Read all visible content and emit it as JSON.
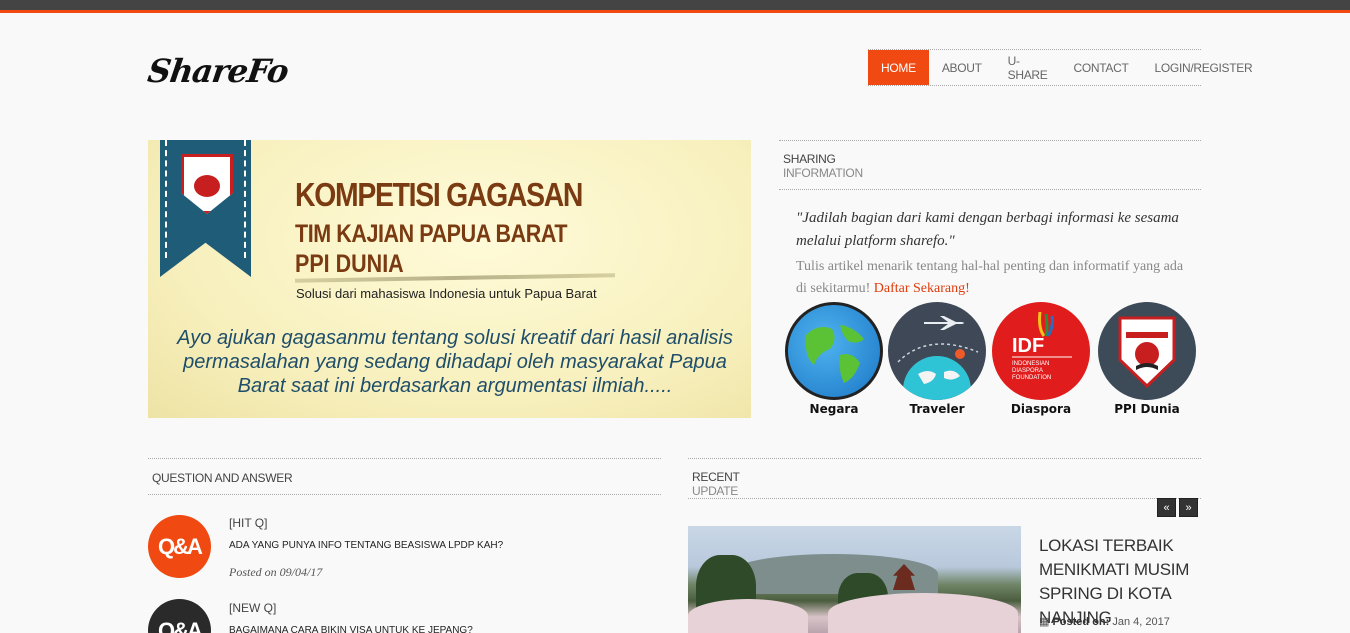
{
  "brand": {
    "logo": "ShareFo",
    "accent": "#f04a12"
  },
  "nav": {
    "items": [
      {
        "label": "HOME",
        "active": true
      },
      {
        "label": "ABOUT",
        "active": false
      },
      {
        "label": "U-SHARE",
        "active": false
      },
      {
        "label": "CONTACT",
        "active": false
      },
      {
        "label": "LOGIN/REGISTER",
        "active": false
      }
    ]
  },
  "banner": {
    "badge_text": "PPI DUNIA",
    "title_line1": "KOMPETISI GAGASAN",
    "title_line2": "TIM KAJIAN PAPUA BARAT",
    "title_line3": "PPI DUNIA",
    "subtitle": "Solusi dari mahasiswa Indonesia untuk Papua Barat",
    "body": "Ayo ajukan gagasanmu tentang solusi kreatif dari hasil analisis permasalahan yang sedang dihadapi oleh masyarakat Papua Barat saat ini berdasarkan argumentasi ilmiah....."
  },
  "sharing": {
    "head_line1": "SHARING",
    "head_line2": "INFORMATION",
    "quote": "\"Jadilah bagian dari kami dengan berbagi informasi ke sesama melalui platform sharefo.\"",
    "desc": "Tulis artikel menarik tentang hal-hal penting dan informatif yang ada di sekitarmu!",
    "cta": "Daftar Sekarang!",
    "categories": [
      {
        "label": "Negara",
        "icon": "globe-icon"
      },
      {
        "label": "Traveler",
        "icon": "airplane-globe-icon"
      },
      {
        "label": "Diaspora",
        "icon": "idf-logo-icon",
        "logo_text": "IDF",
        "logo_sub": "INDONESIAN DIASPORA FOUNDATION"
      },
      {
        "label": "PPI Dunia",
        "icon": "ppi-badge-icon"
      }
    ]
  },
  "qa": {
    "head": "QUESTION AND ANSWER",
    "items": [
      {
        "icon_text": "Q&A",
        "tag": "[HIT Q]",
        "question": "ADA YANG PUNYA INFO TENTANG BEASISWA LPDP KAH?",
        "date": "Posted on 09/04/17"
      },
      {
        "icon_text": "Q&A",
        "tag": "[NEW Q]",
        "question": "BAGAIMANA CARA BIKIN VISA UNTUK KE JEPANG?",
        "date": ""
      }
    ]
  },
  "recent": {
    "head_line1": "RECENT",
    "head_line2": "UPDATE",
    "prev": "«",
    "next": "»",
    "post": {
      "title": "LOKASI TERBAIK MENIKMATI MUSIM SPRING DI KOTA NANJING",
      "meta_label": "Posted on:",
      "meta_date": "Jan 4, 2017"
    }
  }
}
